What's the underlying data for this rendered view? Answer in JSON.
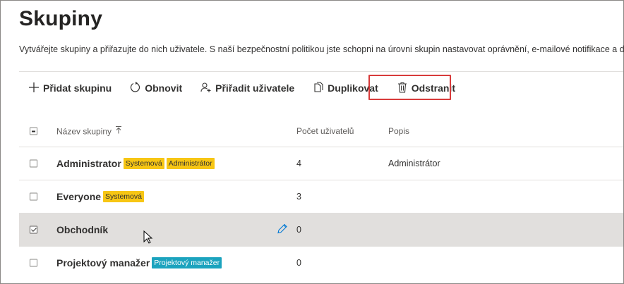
{
  "page": {
    "title": "Skupiny",
    "subtitle": "Vytvářejte skupiny a přiřazujte do nich uživatele. S naší bezpečnostní politikou jste schopni na úrovni skupin nastavovat oprávnění, e-mailové notifikace a další."
  },
  "toolbar": {
    "add_label": "Přidat skupinu",
    "refresh_label": "Obnovit",
    "assign_label": "Přiřadit uživatele",
    "duplicate_label": "Duplikovat",
    "delete_label": "Odstranit"
  },
  "table": {
    "columns": {
      "name": "Název skupiny",
      "count": "Počet uživatelů",
      "description": "Popis"
    },
    "rows": [
      {
        "name": "Administrator",
        "badges": [
          {
            "text": "Systemová",
            "color": "#f7c614"
          },
          {
            "text": "Administrátor",
            "color": "#f7c614"
          }
        ],
        "count": "4",
        "description": "Administrátor",
        "checked": false
      },
      {
        "name": "Everyone",
        "badges": [
          {
            "text": "Systemová",
            "color": "#f7c614"
          }
        ],
        "count": "3",
        "description": "",
        "checked": false
      },
      {
        "name": "Obchodník",
        "badges": [],
        "count": "0",
        "description": "",
        "checked": true
      },
      {
        "name": "Projektový manažer",
        "badges": [
          {
            "text": "Projektový manažer",
            "color": "#1ba3be"
          }
        ],
        "count": "0",
        "description": "",
        "checked": false
      }
    ]
  },
  "colors": {
    "highlight": "#d83b3b",
    "selected_row": "#e1dfdd",
    "accent": "#0078d4"
  }
}
